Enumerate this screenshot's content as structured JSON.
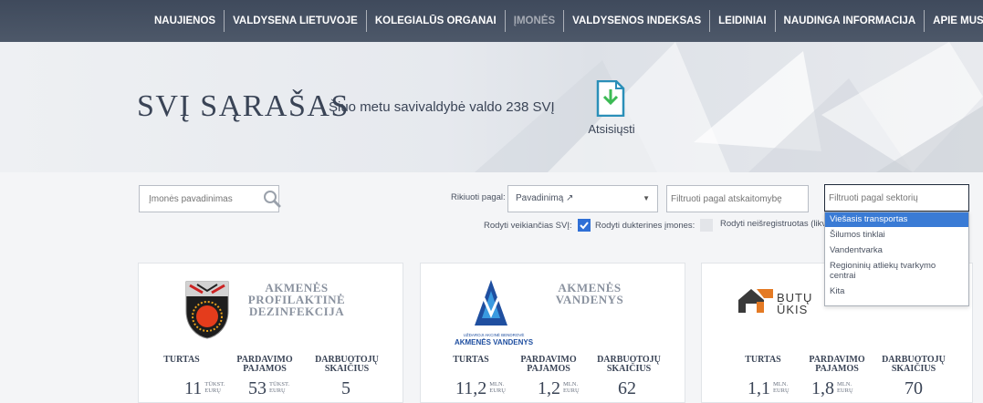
{
  "nav": {
    "items": [
      "NAUJIENOS",
      "VALDYSENA LIETUVOJE",
      "KOLEGIALŪS ORGANAI",
      "ĮMONĖS",
      "VALDYSENOS INDEKSAS",
      "LEIDINIAI",
      "NAUDINGA INFORMACIJA",
      "APIE MUS"
    ],
    "active": "ĮMONĖS"
  },
  "hero": {
    "title": "SVĮ SĄRAŠAS",
    "subtitle": "Šiuo metu savivaldybė valdo 238 SVĮ",
    "download_label": "Atsisiųsti"
  },
  "filters": {
    "search_placeholder": "Įmonės pavadinimas",
    "sort_label": "Rikiuoti pagal:",
    "sort_value": "Pavadinimą ↗",
    "report_placeholder": "Filtruoti pagal atskaitomybę",
    "sector_placeholder": "Filtruoti pagal sektorių",
    "checks": [
      {
        "label": "Rodyti veikiančias SVĮ:",
        "checked": true
      },
      {
        "label": "Rodyti dukterines įmones:",
        "checked": false
      },
      {
        "label": "Rodyti neišregistruotas (likvi",
        "checked": false
      }
    ]
  },
  "sector_options": [
    "Viešasis transportas",
    "Šilumos tinklai",
    "Vandentvarka",
    "Regioninių atliekų tvarkymo centrai",
    "Kita"
  ],
  "sector_selected": "Viešasis transportas",
  "metric_labels": {
    "turtas": "TURTAS",
    "pardavimo_1": "PARDAVIMO",
    "pardavimo_2": "PAJAMOS",
    "darbuotoju_1": "DARBUOTOJŲ",
    "darbuotoju_2": "SKAIČIUS"
  },
  "cards": [
    {
      "name_lines": [
        "AKMENĖS",
        "PROFILAKTINĖ",
        "DEZINFEKCIJA"
      ],
      "turtas": "11",
      "turtas_unit_1": "TŪKST.",
      "turtas_unit_2": "EURŲ",
      "pajamos": "53",
      "pajamos_unit_1": "TŪKST.",
      "pajamos_unit_2": "EURŲ",
      "darbuotojai": "5"
    },
    {
      "name_lines": [
        "AKMENĖS",
        "VANDENYS"
      ],
      "logo_small": "UŽDAROJI AKCINĖ BENDROVĖ",
      "logo_big": "AKMENĖS VANDENYS",
      "turtas": "11,2",
      "turtas_unit_1": "MLN.",
      "turtas_unit_2": "EURŲ",
      "pajamos": "1,2",
      "pajamos_unit_1": "MLN.",
      "pajamos_unit_2": "EURŲ",
      "darbuotojai": "62"
    },
    {
      "logo_text_1": "BUTŲ",
      "logo_text_2": "ŪKIS",
      "turtas": "1,1",
      "turtas_unit_1": "MLN.",
      "turtas_unit_2": "EURŲ",
      "pajamos": "1,8",
      "pajamos_unit_1": "MLN.",
      "pajamos_unit_2": "EURŲ",
      "darbuotojai": "70"
    }
  ],
  "colors": {
    "nav_bg": "#465163",
    "accent_blue": "#2f6fd6",
    "text_dark": "#3a4456",
    "download_icon": "#2a8fb8",
    "download_arrow": "#3cba54",
    "logo_orange": "#e47a24"
  }
}
